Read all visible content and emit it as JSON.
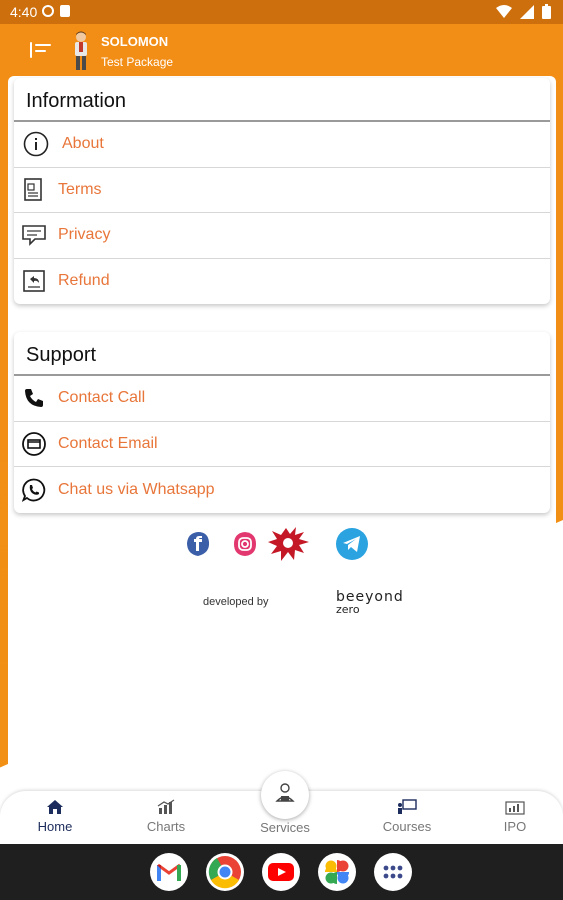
{
  "status_bar": {
    "time": "4:40"
  },
  "header": {
    "user_name": "SOLOMON",
    "package": "Test Package"
  },
  "information": {
    "title": "Information",
    "items": [
      {
        "label": "About",
        "icon": "info-icon"
      },
      {
        "label": "Terms",
        "icon": "document-icon"
      },
      {
        "label": "Privacy",
        "icon": "chat-box-icon"
      },
      {
        "label": "Refund",
        "icon": "refund-icon"
      }
    ]
  },
  "support": {
    "title": "Support",
    "items": [
      {
        "label": "Contact Call",
        "icon": "phone-icon"
      },
      {
        "label": "Contact Email",
        "icon": "email-icon"
      },
      {
        "label": "Chat us via Whatsapp",
        "icon": "whatsapp-icon"
      }
    ]
  },
  "social": [
    "facebook-icon",
    "instagram-icon",
    "splash-icon",
    "telegram-icon"
  ],
  "footer": {
    "developed_by": "developed by",
    "brand_top": "beeyond",
    "brand_bottom": "zero"
  },
  "bottom_nav": {
    "items": [
      {
        "label": "Home",
        "icon": "home-icon"
      },
      {
        "label": "Charts",
        "icon": "chart-icon"
      },
      {
        "label": "Services",
        "icon": "services-icon"
      },
      {
        "label": "Courses",
        "icon": "courses-icon"
      },
      {
        "label": "IPO",
        "icon": "ipo-icon"
      }
    ]
  },
  "dock": [
    "gmail-icon",
    "chrome-icon",
    "youtube-icon",
    "photos-icon",
    "apps-icon"
  ],
  "colors": {
    "accent_orange": "#f28d16",
    "link_orange": "#e8763a",
    "nav_active": "#1c2c5c"
  }
}
